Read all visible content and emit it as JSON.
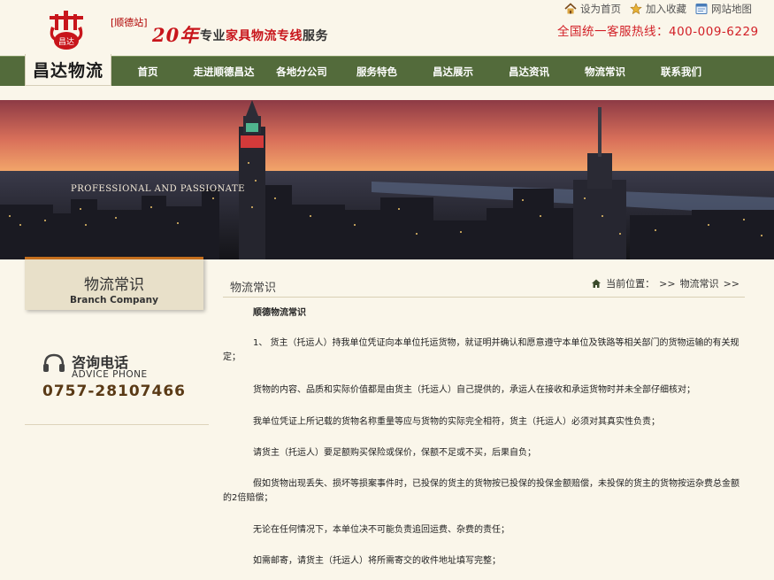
{
  "header": {
    "logo_badge": "昌达",
    "branch_tag": "[顺德站]",
    "years": "20年",
    "slogan_prefix": "专业",
    "slogan_highlight": "家具物流专线",
    "slogan_suffix": "服务",
    "hotline": "全国统一客服热线：400-009-6229",
    "top_links": [
      {
        "label": "设为首页",
        "icon": "home-icon"
      },
      {
        "label": "加入收藏",
        "icon": "star-icon"
      },
      {
        "label": "网站地图",
        "icon": "sitemap-icon"
      }
    ]
  },
  "nav": {
    "logo_text": "昌达物流",
    "items": [
      "首页",
      "走进顺德昌达",
      "各地分公司",
      "服务特色",
      "昌达展示",
      "昌达资讯",
      "物流常识",
      "联系我们"
    ]
  },
  "banner": {
    "caption": "PROFESSIONAL AND PASSIONATE"
  },
  "sidebar": {
    "title_cn": "物流常识",
    "title_en": "Branch Company",
    "advice_cn": "咨询电话",
    "advice_en": "ADVICE PHONE",
    "advice_phone": "0757-28107466"
  },
  "main": {
    "section_title": "物流常识",
    "breadcrumb_label": "当前位置：",
    "breadcrumb_sep": ">>",
    "breadcrumb_current": "物流常识",
    "breadcrumb_end": ">>",
    "article_title": "顺德物流常识",
    "paragraphs": [
      "1、 货主（托运人）持我单位凭证向本单位托运货物，就证明并确认和愿意遵守本单位及铁路等相关部门的货物运输的有关规定；",
      "货物的内容、品质和实际价值都是由货主（托运人）自己提供的，承运人在接收和承运货物时并未全部仔细核对；",
      "我单位凭证上所记载的货物名称重量等应与货物的实际完全相符，货主（托运人）必须对其真实性负责；",
      "请货主（托运人）要足额购买保险或保价，保额不足或不买，后果自负；",
      "假如货物出现丢失、损坏等损案事件时，已投保的货主的货物按已投保的投保金额赔偿，未投保的货主的货物按运杂费总金额的2倍赔偿；",
      "无论在任何情况下，本单位决不可能负责追回运费、杂费的责任；",
      "如需邮寄，请货主（托运人）将所需寄交的收件地址填写完整；"
    ]
  },
  "colors": {
    "nav_green": "#536b3b",
    "brand_red": "#c8151b",
    "sidebar_accent": "#c56f1e",
    "page_bg": "#faf6ea"
  }
}
